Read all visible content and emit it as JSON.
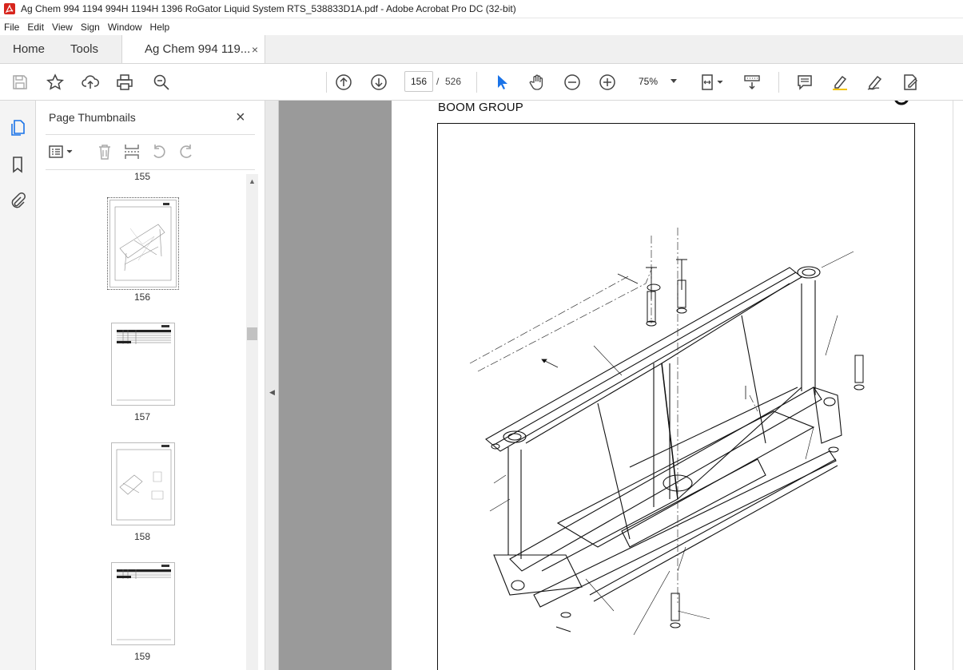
{
  "window": {
    "title": "Ag Chem 994 1194 994H 1194H 1396 RoGator Liquid System RTS_538833D1A.pdf - Adobe Acrobat Pro DC (32-bit)",
    "app_icon": "acrobat-icon"
  },
  "menu": [
    "File",
    "Edit",
    "View",
    "Sign",
    "Window",
    "Help"
  ],
  "tabs": {
    "home": "Home",
    "tools": "Tools",
    "document": "Ag Chem 994 119...",
    "close": "×"
  },
  "toolbar": {
    "current_page": "156",
    "separator": "/",
    "total_pages": "526",
    "zoom": "75%",
    "icons": [
      "save-icon",
      "bookmark-star-icon",
      "upload-icon",
      "print-icon",
      "search-zoom-icon",
      "page-up-icon",
      "page-down-icon",
      "select-cursor-icon",
      "hand-icon",
      "zoom-out-icon",
      "zoom-in-icon",
      "fit-page-icon",
      "scroll-mode-icon",
      "comment-icon",
      "highlight-icon",
      "sign-icon",
      "edit-pdf-icon"
    ]
  },
  "sidebar_rail": {
    "icons": [
      "page-thumbnails-icon",
      "bookmarks-icon",
      "attachments-icon"
    ]
  },
  "thumbnails_panel": {
    "title": "Page Thumbnails",
    "close": "×",
    "tools": [
      "options-menu-icon",
      "delete-icon",
      "insert-pages-icon",
      "undo-icon",
      "redo-icon"
    ],
    "prev_label": "155",
    "pages": [
      {
        "label": "156",
        "selected": true,
        "kind": "drawing"
      },
      {
        "label": "157",
        "selected": false,
        "kind": "table"
      },
      {
        "label": "158",
        "selected": false,
        "kind": "drawing"
      },
      {
        "label": "159",
        "selected": false,
        "kind": "table"
      }
    ]
  },
  "document": {
    "heading": "BOOM GROUP"
  }
}
